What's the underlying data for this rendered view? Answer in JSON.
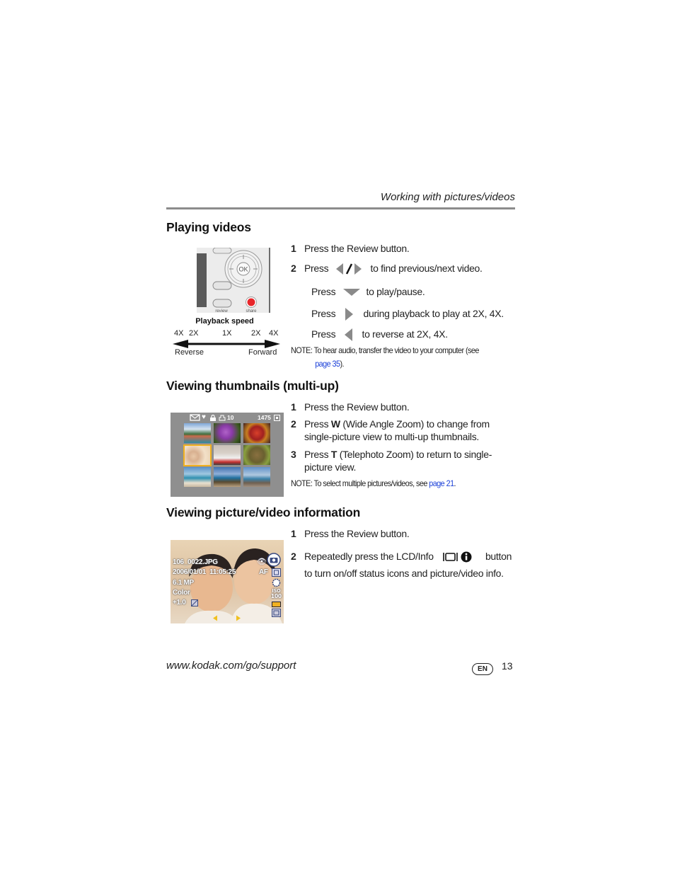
{
  "header": {
    "section_title": "Working with pictures/videos"
  },
  "sections": {
    "playing_videos": {
      "title": "Playing videos",
      "image": {
        "buttons": {
          "ok_label": "OK",
          "review_label": "review",
          "share_label": "share"
        },
        "speed_title": "Playback speed",
        "ticks": [
          "4X",
          "2X",
          "1X",
          "2X",
          "4X"
        ],
        "reverse_label": "Reverse",
        "forward_label": "Forward"
      },
      "steps": [
        {
          "num": "1",
          "text": "Press the Review button."
        },
        {
          "num": "2",
          "pre": "Press",
          "icon": "left-right-arrows-icon",
          "post": "to find previous/next video."
        }
      ],
      "sub_steps": [
        {
          "pre": "Press",
          "icon": "down-arrow-icon",
          "post": "to play/pause."
        },
        {
          "pre": "Press",
          "icon": "right-arrow-icon",
          "post": "during playback to play at 2X, 4X."
        },
        {
          "pre": "Press",
          "icon": "left-arrow-icon",
          "post": "to reverse at 2X, 4X."
        }
      ],
      "note": {
        "prefix": "NOTE:",
        "text": "To hear audio, transfer the video to your computer (see",
        "link": "page 35",
        "suffix": ")."
      }
    },
    "thumbnails": {
      "title": "Viewing thumbnails (multi-up)",
      "image": {
        "status_left": "10",
        "status_right": "1475"
      },
      "steps": [
        {
          "num": "1",
          "text": "Press the Review button."
        },
        {
          "num": "2",
          "pre": "Press ",
          "bold": "W",
          "post": " (Wide Angle Zoom) to change from single-picture view to multi-up thumbnails."
        },
        {
          "num": "3",
          "pre": "Press ",
          "bold": "T",
          "post": " (Telephoto Zoom) to return to single-picture view."
        }
      ],
      "note": {
        "prefix": "NOTE:",
        "text": "To select multiple pictures/videos, see",
        "link": "page 21",
        "suffix": "."
      }
    },
    "info": {
      "title": "Viewing picture/video information",
      "image": {
        "filename": "106_0022.JPG",
        "datetime": "2006/01/01  11:05:25",
        "resolution": "6.1 MP",
        "color_mode": "Color",
        "exposure": "+1.0",
        "af_label": "AF",
        "iso_label": "ISO",
        "iso_value": "100"
      },
      "steps": [
        {
          "num": "1",
          "text": "Press the Review button."
        },
        {
          "num": "2",
          "pre": "Repeatedly press the LCD/Info",
          "icon": "lcd-info-icon",
          "post": "button to turn on/off status icons and picture/video info."
        }
      ]
    }
  },
  "footer": {
    "url": "www.kodak.com/go/support",
    "language_badge": "EN",
    "page_number": "13"
  },
  "colors": {
    "link": "#1a3fd8",
    "rule": "#8c8c8c",
    "highlight": "#f0b020",
    "share_red": "#e8262a"
  }
}
